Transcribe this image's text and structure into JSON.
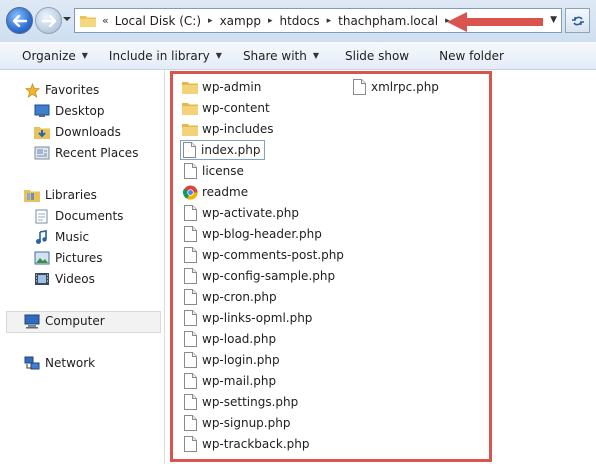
{
  "address": {
    "lead": "«",
    "crumbs": [
      "Local Disk (C:)",
      "xampp",
      "htdocs",
      "thachpham.local"
    ],
    "sep": "▸",
    "dropdown": "▼"
  },
  "toolbar": {
    "organize": "Organize",
    "include": "Include in library",
    "share": "Share with",
    "slideshow": "Slide show",
    "newfolder": "New folder",
    "caret": "▼"
  },
  "nav": {
    "favorites": "Favorites",
    "desktop": "Desktop",
    "downloads": "Downloads",
    "recent": "Recent Places",
    "libraries": "Libraries",
    "documents": "Documents",
    "music": "Music",
    "pictures": "Pictures",
    "videos": "Videos",
    "computer": "Computer",
    "network": "Network"
  },
  "files": {
    "col1": [
      {
        "name": "wp-admin",
        "icon": "folder-icon"
      },
      {
        "name": "wp-content",
        "icon": "folder-icon"
      },
      {
        "name": "wp-includes",
        "icon": "folder-icon"
      },
      {
        "name": "index.php",
        "icon": "file-icon"
      },
      {
        "name": "license",
        "icon": "file-icon"
      },
      {
        "name": "readme",
        "icon": "chrome-icon"
      },
      {
        "name": "wp-activate.php",
        "icon": "file-icon"
      },
      {
        "name": "wp-blog-header.php",
        "icon": "file-icon"
      },
      {
        "name": "wp-comments-post.php",
        "icon": "file-icon"
      },
      {
        "name": "wp-config-sample.php",
        "icon": "file-icon"
      },
      {
        "name": "wp-cron.php",
        "icon": "file-icon"
      },
      {
        "name": "wp-links-opml.php",
        "icon": "file-icon"
      },
      {
        "name": "wp-load.php",
        "icon": "file-icon"
      },
      {
        "name": "wp-login.php",
        "icon": "file-icon"
      },
      {
        "name": "wp-mail.php",
        "icon": "file-icon"
      },
      {
        "name": "wp-settings.php",
        "icon": "file-icon"
      },
      {
        "name": "wp-signup.php",
        "icon": "file-icon"
      },
      {
        "name": "wp-trackback.php",
        "icon": "file-icon"
      }
    ],
    "col2": [
      {
        "name": "xmlrpc.php",
        "icon": "file-icon"
      }
    ]
  },
  "colors": {
    "annotation": "#d9534f",
    "selection_border": "#7da2ce"
  }
}
